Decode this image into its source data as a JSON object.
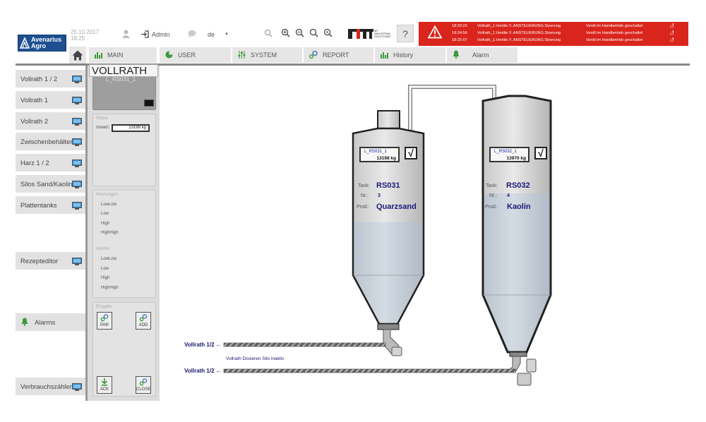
{
  "header": {
    "logo_line1": "Avenarius",
    "logo_line2": "Agro",
    "date": "25.10.2017",
    "time": "18:25",
    "user": "Admin",
    "language": "de",
    "brand_text": "MT INDUSTRIAL SOLUTIONS",
    "help": "?"
  },
  "alarms": [
    {
      "time": "18:20:23",
      "source": "Vollrath_1.Ventile.Y..ANSTEUERUNG.Stoerung",
      "message": "Ventil im Handbetrieb geschaltet",
      "action": "↓!"
    },
    {
      "time": "18:24:56",
      "source": "Vollrath_1.Ventile.Y..ANSTEUERUNG.Stoerung",
      "message": "Ventil im Handbetrieb geschaltet",
      "action": "↓!"
    },
    {
      "time": "18:25:07",
      "source": "Vollrath_1.Ventile.Y..ANSTEUERUNG.Stoerung",
      "message": "Ventil im Handbetrieb geschaltet",
      "action": "↓!"
    }
  ],
  "nav": {
    "tabs": [
      "MAIN",
      "USER",
      "SYSTEM",
      "REPORT",
      "History",
      "Alarm"
    ]
  },
  "sidebar": {
    "items": [
      "Vollrath 1 / 2",
      "Vollrath 1",
      "Vollrath 2",
      "Zwischenbehälter",
      "Harz 1 / 2",
      "Silos Sand/Kaolin",
      "Plattentanks",
      "Rezepteditor",
      "Alarms",
      "Verbrauchszähler"
    ]
  },
  "panel": {
    "title": "VOLLRATH",
    "preview_label": "L_RS031_1",
    "status_label": "Status",
    "istwert_label": "Istwert:",
    "istwert_value": "13198 kg",
    "warnings_label": "Warnungen",
    "warnings": [
      "LowLow",
      "Low",
      "High",
      "HighHigh"
    ],
    "alarms_label": "Alarme:",
    "alarms": [
      "LowLow",
      "Low",
      "High",
      "HighHigh"
    ],
    "input_label": "Eingabe:",
    "buttons": {
      "par": "PAR",
      "add": "ADD",
      "ack": "ACK",
      "close": "CLOSE"
    }
  },
  "silos": [
    {
      "tag": "L_RS031_1",
      "weight": "13198 kg",
      "tank_label": "Tank:",
      "tank": "RS031",
      "nr_label": "Nr.:",
      "nr": "3",
      "prod_label": "Prod.:",
      "prod": "Quarzsand",
      "check": "√",
      "fill_fraction": 0.52
    },
    {
      "tag": "L_RS032_1",
      "weight": "13970 kg",
      "tank_label": "Tank:",
      "tank": "RS032",
      "nr_label": "Nr.:",
      "nr": "4",
      "prod_label": "Prod.:",
      "prod": "Kaolin",
      "check": "√",
      "fill_fraction": 0.62
    }
  ],
  "lines": {
    "line1": "Vollrath 1/2 ←",
    "line2": "Vollrath 1/2 ←",
    "status": "Vollrath Dosieren Silo inaktiv"
  },
  "colors": {
    "brand_blue": "#1d4f91",
    "alarm_red": "#d9251c",
    "tab_grey": "#e6e6e6",
    "silo_fill": "#c3ccd6",
    "text_blue": "#1a1a7a"
  }
}
